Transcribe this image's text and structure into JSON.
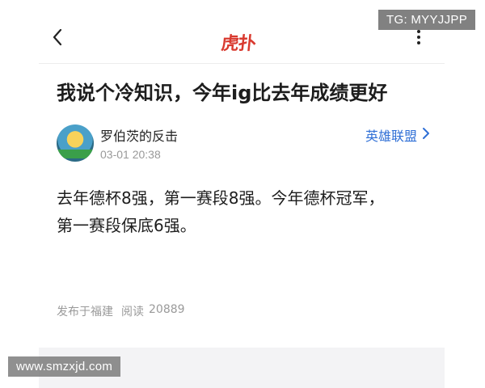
{
  "header": {
    "back_icon": "chevron-left-icon",
    "logo_text": "虎扑",
    "more_icon": "vertical-dots-icon"
  },
  "post": {
    "title": "我说个冷知识，今年ig比去年成绩更好",
    "author": "罗伯茨的反击",
    "time": "03-01 20:38",
    "category": "英雄联盟",
    "body_line1": "去年德杯8强，第一赛段8强。今年德杯冠军，",
    "body_line2": "第一赛段保底6强。",
    "location": "发布于福建",
    "reads_label": "阅读",
    "reads_count": "20889"
  },
  "watermarks": {
    "tg": "TG: MYYJJPP",
    "site": "www.smzxjd.com"
  },
  "colors": {
    "logo": "#d93a2f",
    "link": "#2f6fd6",
    "meta": "#9a9a9a"
  }
}
